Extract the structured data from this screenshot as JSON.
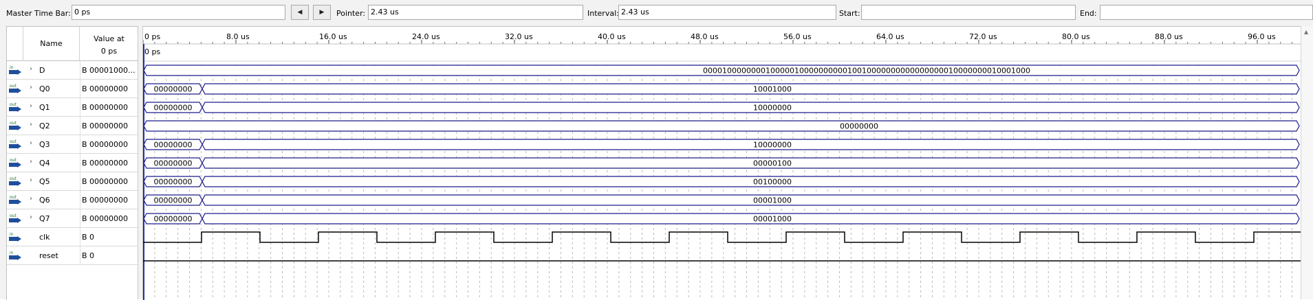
{
  "toolbar": {
    "master_time_bar_label": "Master Time Bar:",
    "master_time_bar_value": "0 ps",
    "prev_icon": "left-arrow-icon",
    "next_icon": "right-arrow-icon",
    "pointer_label": "Pointer:",
    "pointer_value": "2.43 us",
    "interval_label": "Interval:",
    "interval_value": "2.43 us",
    "start_label": "Start:",
    "start_value": "",
    "end_label": "End:",
    "end_value": ""
  },
  "list_header": {
    "name_col": "Name",
    "value_col_line1": "Value at",
    "value_col_line2": "0 ps"
  },
  "timeline": {
    "ticks": [
      "0 ps",
      "8.0 us",
      "16.0 us",
      "24.0 us",
      "32.0 us",
      "40.0 us",
      "48.0 us",
      "56.0 us",
      "64.0 us",
      "72.0 us",
      "80.0 us",
      "88.0 us",
      "96.0 us"
    ],
    "cursor_label": "0 ps"
  },
  "signals": [
    {
      "type": "in",
      "name": "D",
      "value": "B 00001000...",
      "initial": "",
      "final": "00001000000001000001000000000010010000000000000000010000000010001000",
      "transition": false
    },
    {
      "type": "out",
      "name": "Q0",
      "value": "B 00000000",
      "initial": "00000000",
      "final": "10001000",
      "transition": true
    },
    {
      "type": "out",
      "name": "Q1",
      "value": "B 00000000",
      "initial": "00000000",
      "final": "10000000",
      "transition": true
    },
    {
      "type": "out",
      "name": "Q2",
      "value": "B 00000000",
      "initial": "",
      "final": "00000000",
      "transition": false
    },
    {
      "type": "out",
      "name": "Q3",
      "value": "B 00000000",
      "initial": "00000000",
      "final": "10000000",
      "transition": true
    },
    {
      "type": "out",
      "name": "Q4",
      "value": "B 00000000",
      "initial": "00000000",
      "final": "00000100",
      "transition": true
    },
    {
      "type": "out",
      "name": "Q5",
      "value": "B 00000000",
      "initial": "00000000",
      "final": "00100000",
      "transition": true
    },
    {
      "type": "out",
      "name": "Q6",
      "value": "B 00000000",
      "initial": "00000000",
      "final": "00001000",
      "transition": true
    },
    {
      "type": "out",
      "name": "Q7",
      "value": "B 00000000",
      "initial": "00000000",
      "final": "00001000",
      "transition": true
    },
    {
      "type": "in",
      "name": "clk",
      "value": "B 0",
      "kind": "clock"
    },
    {
      "type": "in",
      "name": "reset",
      "value": "B 0",
      "kind": "low"
    }
  ],
  "colors": {
    "wave": "#1a1a8c",
    "bit": "#000000",
    "grid": "#b8b8b8"
  }
}
